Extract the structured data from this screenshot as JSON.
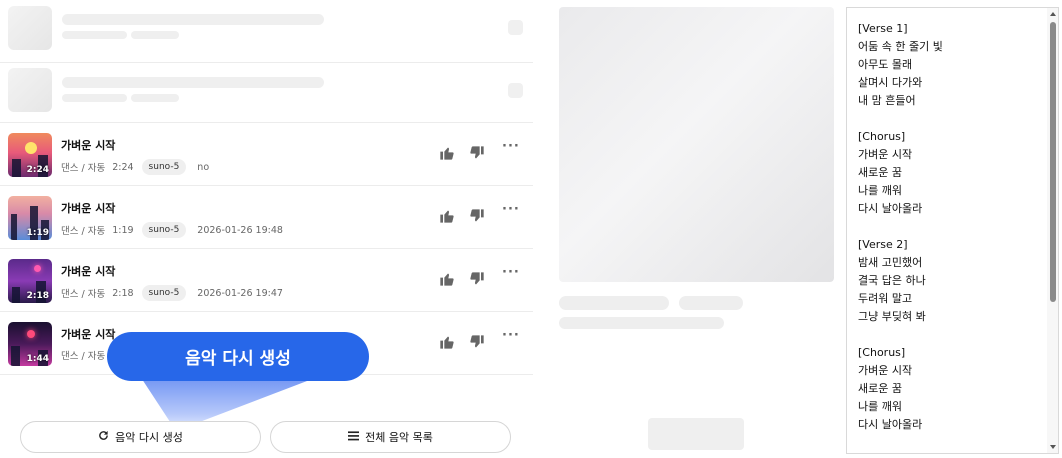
{
  "tracks": [
    {
      "title": "가벼운 시작",
      "genre": "댄스 / 자동",
      "duration": "2:24",
      "model": "suno-5",
      "date": "no"
    },
    {
      "title": "가벼운 시작",
      "genre": "댄스 / 자동",
      "duration": "1:19",
      "model": "suno-5",
      "date": "2026-01-26 19:48"
    },
    {
      "title": "가벼운 시작",
      "genre": "댄스 / 자동",
      "duration": "2:18",
      "model": "suno-5",
      "date": "2026-01-26 19:47"
    },
    {
      "title": "가벼운 시작",
      "genre": "댄스 / 자동",
      "duration": "1:44"
    }
  ],
  "tooltip": {
    "text": "음악 다시 생성"
  },
  "buttons": {
    "regenerate": {
      "label": "음악 다시 생성",
      "icon": "refresh-icon"
    },
    "all_list": {
      "label": "전체 음악 목록",
      "icon": "list-icon"
    }
  },
  "lyrics": [
    "[Verse 1]",
    "어둠 속 한 줄기 빛",
    "아무도 몰래",
    "살며시 다가와",
    "내 맘 흔들어",
    "",
    "[Chorus]",
    "가벼운 시작",
    "새로운 꿈",
    "나를 깨워",
    "다시 날아올라",
    "",
    "[Verse 2]",
    "밤새 고민했어",
    "결국 답은 하나",
    "두려워 말고",
    "그냥 부딪혀 봐",
    "",
    "[Chorus]",
    "가벼운 시작",
    "새로운 꿈",
    "나를 깨워",
    "다시 날아올라"
  ],
  "colors": {
    "accent": "#2767e9",
    "thumb_1": "#e85a7a",
    "thumb_2": "#5a8cd8",
    "thumb_3": "#8a3bb5",
    "thumb_4": "#c43aa0"
  }
}
